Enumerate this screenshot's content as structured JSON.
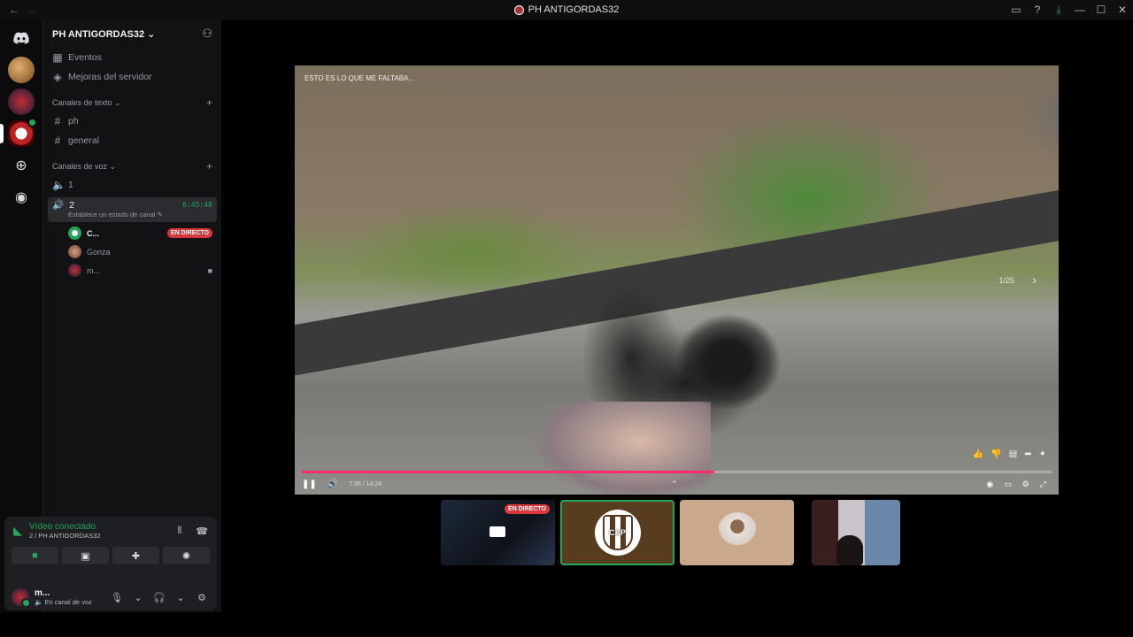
{
  "window": {
    "title": "PH ANTIGORDAS32",
    "back_glyph": "←",
    "forward_glyph": "→",
    "icons": [
      "screen-share-icon",
      "help-icon",
      "download-icon"
    ],
    "controls": [
      "—",
      "☐",
      "✕"
    ]
  },
  "server": {
    "name": "PH ANTIGORDAS32",
    "menu": [
      {
        "label": "Eventos",
        "icon": "calendar-icon"
      },
      {
        "label": "Mejoras del servidor",
        "icon": "boost-icon"
      }
    ],
    "text_category": "Canales de texto",
    "text_channels": [
      "ph",
      "general"
    ],
    "voice_category": "Canales de voz",
    "voice_channels": [
      {
        "name": "1"
      },
      {
        "name": "2",
        "time": "6:45:48",
        "status": "Establece un estado de canal"
      }
    ],
    "voice_members": [
      {
        "name": "C...",
        "badge": "EN DIRECTO"
      },
      {
        "name": "Gonza"
      },
      {
        "name": "m..."
      }
    ]
  },
  "voice_panel": {
    "status": "Vídeo conectado",
    "location": "2 / PH ANTIGORDAS32"
  },
  "user": {
    "name": "m...",
    "status": "En canal de voz"
  },
  "video": {
    "caption": "ESTO ES LO QUE ME FALTABA...",
    "page": "1/25",
    "time": "7:36 / 14:24",
    "progress": 0.55
  },
  "tiles": {
    "live_label": "EN DIRECTO",
    "cap_text": "CAP"
  },
  "colors": {
    "accent_green": "#23a55a",
    "live_red": "#da373c",
    "progress": "#ff2b6b"
  }
}
